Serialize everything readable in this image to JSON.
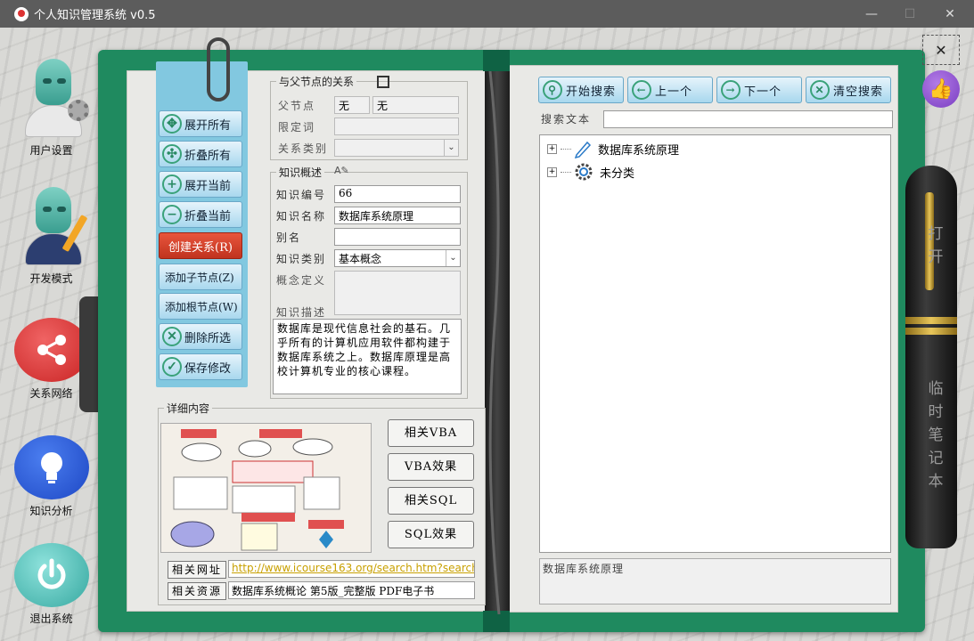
{
  "window": {
    "title": "个人知识管理系统 v0.5",
    "min": "—",
    "max": "☐",
    "close": "✕"
  },
  "sidebar": {
    "items": [
      {
        "label": "用户设置"
      },
      {
        "label": "开发模式"
      },
      {
        "label": "关系网络",
        "glyph": "⋖"
      },
      {
        "label": "知识分析",
        "glyph": "💡"
      },
      {
        "label": "退出系统",
        "glyph": "⏻"
      }
    ]
  },
  "actions": {
    "expand_all": "展开所有",
    "collapse_all": "折叠所有",
    "expand_current": "展开当前",
    "collapse_current": "折叠当前",
    "create_relation": "创建关系(R)",
    "add_child": "添加子节点(Z)",
    "add_root": "添加根节点(W)",
    "delete_selected": "删除所选",
    "save_changes": "保存修改"
  },
  "parent_relation": {
    "title": "与父节点的关系",
    "parent_label": "父节点",
    "parent_value1": "无",
    "parent_value2": "无",
    "qualifier_label": "限定词",
    "qualifier_value": "",
    "relation_type_label": "关系类别",
    "relation_type_value": ""
  },
  "overview": {
    "title": "知识概述",
    "id_label": "知识编号",
    "id_value": "66",
    "name_label": "知识名称",
    "name_value": "数据库系统原理",
    "alias_label": "别名",
    "alias_value": "",
    "category_label": "知识类别",
    "category_value": "基本概念",
    "definition_label": "概念定义",
    "description_label": "知识描述",
    "description_value": "数据库是现代信息社会的基石。几乎所有的计算机应用软件都构建于数据库系统之上。数据库原理是高校计算机专业的核心课程。"
  },
  "details": {
    "title": "详细内容",
    "related_vba": "相关VBA",
    "vba_effect": "VBA效果",
    "related_sql": "相关SQL",
    "sql_effect": "SQL效果",
    "url_label": "相关网址",
    "url_value": "http://www.icourse163.org/search.htm?search",
    "resource_label": "相关资源",
    "resource_value": "数据库系统概论 第5版_完整版 PDF电子书"
  },
  "search": {
    "start": "开始搜索",
    "prev": "上一个",
    "next": "下一个",
    "clear": "清空搜索",
    "text_label": "搜索文本",
    "text_value": ""
  },
  "tree": {
    "nodes": [
      {
        "label": "数据库系统原理",
        "icon": "pencil-icon"
      },
      {
        "label": "未分类",
        "icon": "gear-icon"
      }
    ]
  },
  "status_text": "数据库系统原理",
  "pen": {
    "top_text": "打开",
    "bottom_text": "临时笔记本"
  },
  "floating": {
    "close": "✕",
    "like": "👍"
  }
}
